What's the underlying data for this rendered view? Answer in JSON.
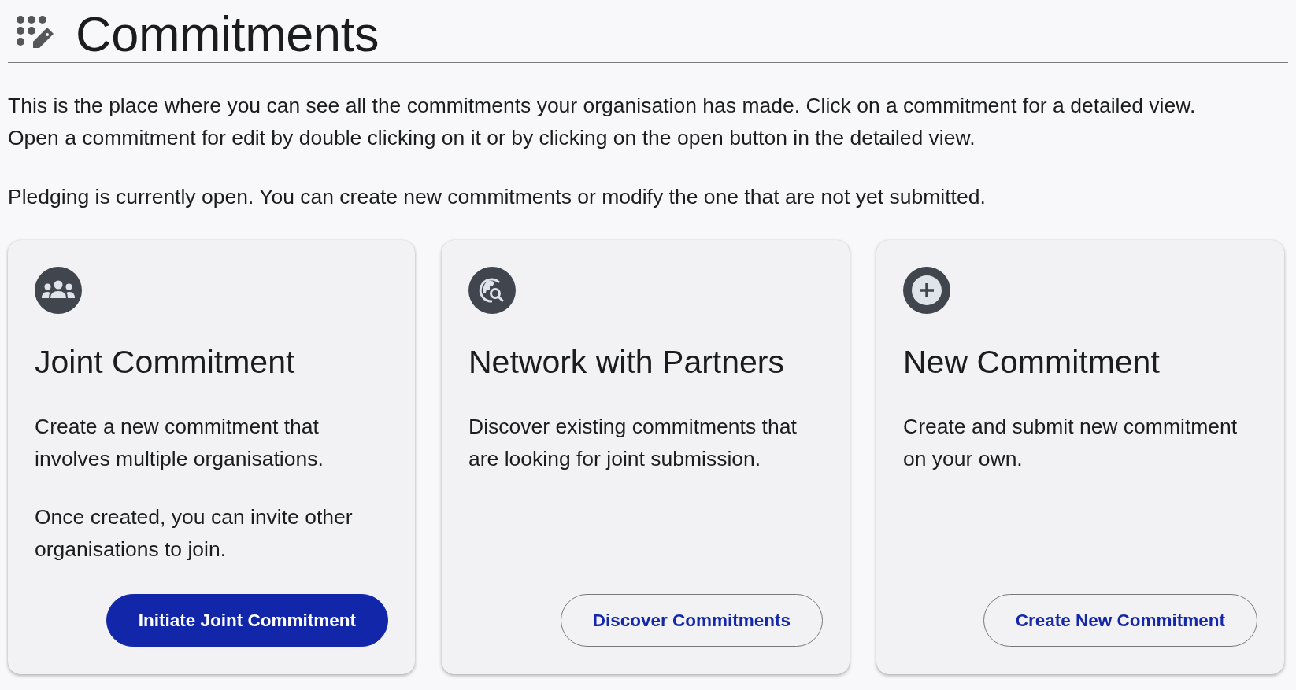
{
  "header": {
    "title": "Commitments"
  },
  "intro": {
    "lines": [
      "This is the place where you can see all the commitments your organisation has made. Click on a commitment for a detailed view.",
      "Open a commitment for edit by double clicking on it or by clicking on the open button in the detailed view."
    ],
    "status": "Pledging is currently open. You can create new commitments or modify the one that are not yet submitted."
  },
  "cards": [
    {
      "kind": "group",
      "title": "Joint Commitment",
      "paragraphs": [
        "Create a new commitment that involves multiple organisations.",
        "Once created, you can invite other organisations to join."
      ],
      "button": {
        "label": "Initiate Joint Commitment",
        "primary": true
      }
    },
    {
      "kind": "discover",
      "title": "Network with Partners",
      "paragraphs": [
        "Discover existing commitments that are looking for joint submission."
      ],
      "button": {
        "label": "Discover Commitments",
        "primary": false
      }
    },
    {
      "kind": "create",
      "title": "New Commitment",
      "paragraphs": [
        "Create and submit new commitment on your own."
      ],
      "button": {
        "label": "Create New Commitment",
        "primary": false
      }
    }
  ]
}
